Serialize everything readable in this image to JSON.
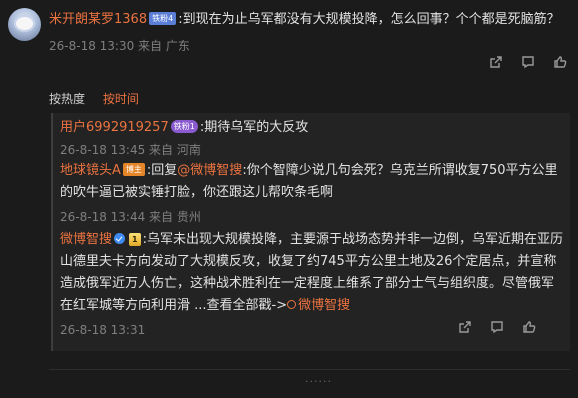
{
  "main_comment": {
    "user": "米开朗某罗1368",
    "badge": "铁粉4",
    "text": ":到现在为止乌军都没有大规模投降，怎么回事？个个都是死脑筋？",
    "meta": "26-8-18 13:30 来自 广东"
  },
  "sort": {
    "heat": "按热度",
    "time": "按时间"
  },
  "replies": [
    {
      "user": "用户6992919257",
      "badge": "铁粉1",
      "text": ":期待乌军的大反攻",
      "meta": "26-8-18 13:45 来自 河南"
    },
    {
      "user": "地球镜头A",
      "badge": "博主",
      "prefix": ":回复",
      "mention": "@微博智搜",
      "text": ":你个智障少说几句会死？乌克兰所谓收复750平方公里的吹牛逼已被实锤打脸，你还跟这儿帮吹条毛啊",
      "meta": "26-8-18 13:44 来自 贵州"
    },
    {
      "user": "微博智搜",
      "crown_badge": "1",
      "text": ":乌军未出现大规模投降，主要源于战场态势并非一边倒，乌军近期在亚历山德里夫卡方向发动了大规模反攻，收复了约745平方公里土地及26个定居点，并宣称造成俄军近万人伤亡，这种战术胜利在一定程度上维系了部分士气与组织度。尽管俄军在红军城等方向利用滑 ...查看全部戳->",
      "link_text": "微博智搜",
      "meta": "26-8-18 13:31"
    }
  ],
  "bottom_indicator": "......"
}
